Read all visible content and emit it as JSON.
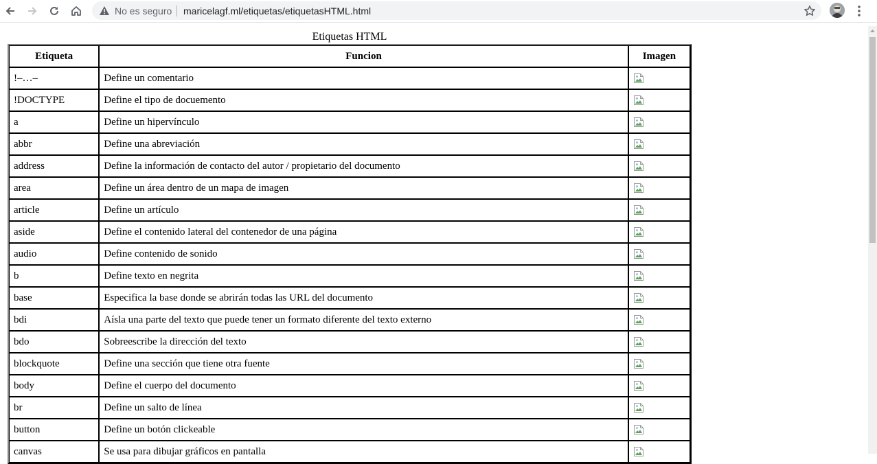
{
  "browser": {
    "insecure_label": "No es seguro",
    "url": "maricelagf.ml/etiquetas/etiquetasHTML.html"
  },
  "page": {
    "caption": "Etiquetas HTML",
    "headers": [
      "Etiqueta",
      "Funcion",
      "Imagen"
    ],
    "rows": [
      {
        "tag": "!–…–",
        "desc": "Define un comentario"
      },
      {
        "tag": "!DOCTYPE",
        "desc": "Define el tipo de docuemento"
      },
      {
        "tag": "a",
        "desc": "Define un hipervínculo"
      },
      {
        "tag": "abbr",
        "desc": "Define una abreviación"
      },
      {
        "tag": "address",
        "desc": "Define la información de contacto del autor / propietario del documento"
      },
      {
        "tag": "area",
        "desc": "Define un área dentro de un mapa de imagen"
      },
      {
        "tag": "article",
        "desc": "Define un artículo"
      },
      {
        "tag": "aside",
        "desc": "Define el contenido lateral del contenedor de una página"
      },
      {
        "tag": "audio",
        "desc": "Define contenido de sonido"
      },
      {
        "tag": "b",
        "desc": "Define texto en negrita"
      },
      {
        "tag": "base",
        "desc": "Especifica la base donde se abrirán todas las URL del documento"
      },
      {
        "tag": "bdi",
        "desc": "Aísla una parte del texto que puede tener un formato diferente del texto externo"
      },
      {
        "tag": "bdo",
        "desc": "Sobreescribe la dirección del texto"
      },
      {
        "tag": "blockquote",
        "desc": "Define una sección que tiene otra fuente"
      },
      {
        "tag": "body",
        "desc": "Define el cuerpo del documento"
      },
      {
        "tag": "br",
        "desc": "Define un salto de línea"
      },
      {
        "tag": "button",
        "desc": "Define un botón clickeable"
      },
      {
        "tag": "canvas",
        "desc": "Se usa para dibujar gráficos en pantalla"
      }
    ]
  }
}
